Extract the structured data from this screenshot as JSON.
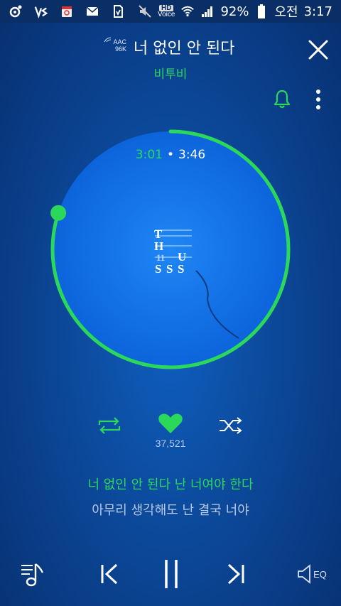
{
  "status_bar": {
    "battery": "92%",
    "time_prefix": "오전",
    "time": "3:17",
    "hd_label": "HD",
    "voice_label": "Voice",
    "icons": [
      "music-app-icon",
      "vs-icon",
      "calendar-icon",
      "mail-icon",
      "download-icon",
      "mute-icon",
      "hd-voice-icon",
      "wifi-icon",
      "signal-icon",
      "battery-icon"
    ]
  },
  "header": {
    "codec": "AAC",
    "bitrate": "96K",
    "title": "너 없인 안 된다",
    "artist": "비투비"
  },
  "player": {
    "current_time": "3:01",
    "separator": "•",
    "total_time": "3:46",
    "progress_fraction": 0.8,
    "album_art_text": [
      "T",
      "H",
      "11",
      "U",
      "S",
      "S",
      "S"
    ]
  },
  "actions": {
    "like_count": "37,521"
  },
  "lyrics": {
    "current": "너 없인 안 된다 난 너여야 한다",
    "next": "아무리 생각해도 난 결국 너야"
  },
  "bottom": {
    "eq_label": "EQ"
  },
  "colors": {
    "accent": "#2bd85a",
    "disc": "#1170e6",
    "background": "#0c4a9c"
  }
}
